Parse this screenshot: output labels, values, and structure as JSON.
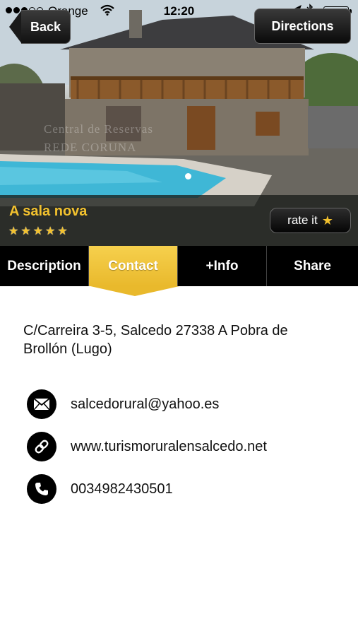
{
  "status_bar": {
    "carrier": "Orange",
    "time": "12:20",
    "signal_bars_filled": 3,
    "signal_bars_total": 5,
    "icons": [
      "wifi-icon",
      "location-arrow-icon",
      "bluetooth-icon",
      "battery-icon"
    ]
  },
  "nav": {
    "back_label": "Back",
    "directions_label": "Directions"
  },
  "hero": {
    "watermark_line1": "Central de Reservas",
    "watermark_line2": "REDE CORUNA",
    "page_indicator": {
      "current": 1,
      "total": 1
    }
  },
  "place": {
    "name": "A sala nova",
    "rating_stars": 5,
    "rate_label": "rate it"
  },
  "tabs": [
    {
      "label": "Description",
      "active": false
    },
    {
      "label": "Contact",
      "active": true
    },
    {
      "label": "+Info",
      "active": false
    },
    {
      "label": "Share",
      "active": false
    }
  ],
  "contact": {
    "address": "C/Carreira 3-5, Salcedo 27338  A Pobra de Brollón (Lugo)",
    "email": "salcedorural@yahoo.es",
    "website": "www.turismoruralensalcedo.net",
    "phone": "0034982430501"
  },
  "colors": {
    "accent": "#f2c12e",
    "tab_active": "#e9b92c",
    "bar_dark": "#000000"
  }
}
